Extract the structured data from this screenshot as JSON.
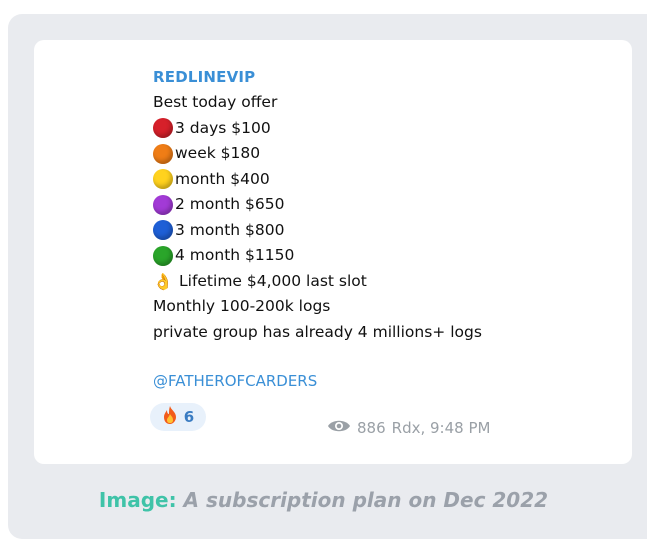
{
  "message": {
    "sender": "REDLINEVIP",
    "lines": [
      {
        "text": "Best today offer"
      },
      {
        "emoji": "red-circle",
        "color": "#d6202a",
        "text": "3 days $100"
      },
      {
        "emoji": "orange-circle",
        "color": "#ef7d16",
        "text": "week $180"
      },
      {
        "emoji": "yellow-circle",
        "color": "#ffd21e",
        "text": "month $400"
      },
      {
        "emoji": "purple-circle",
        "color": "#a23ad6",
        "text": "2 month $650"
      },
      {
        "emoji": "blue-circle",
        "color": "#1e5fd6",
        "text": "3 month $800"
      },
      {
        "emoji": "green-circle",
        "color": "#2aa52a",
        "text": "4 month $1150"
      },
      {
        "emoji": "ok-hand",
        "text": "Lifetime $4,000 last slot"
      },
      {
        "text": "Monthly 100-200k logs"
      },
      {
        "text": "private group has already 4 millions+ logs"
      }
    ],
    "mention": "@FATHEROFCARDERS",
    "reaction": {
      "emoji": "fire",
      "count": "6"
    },
    "views": "886",
    "author_time": "Rdx, 9:48 PM"
  },
  "caption": {
    "label": "Image:",
    "text": "A subscription plan on Dec 2022"
  }
}
